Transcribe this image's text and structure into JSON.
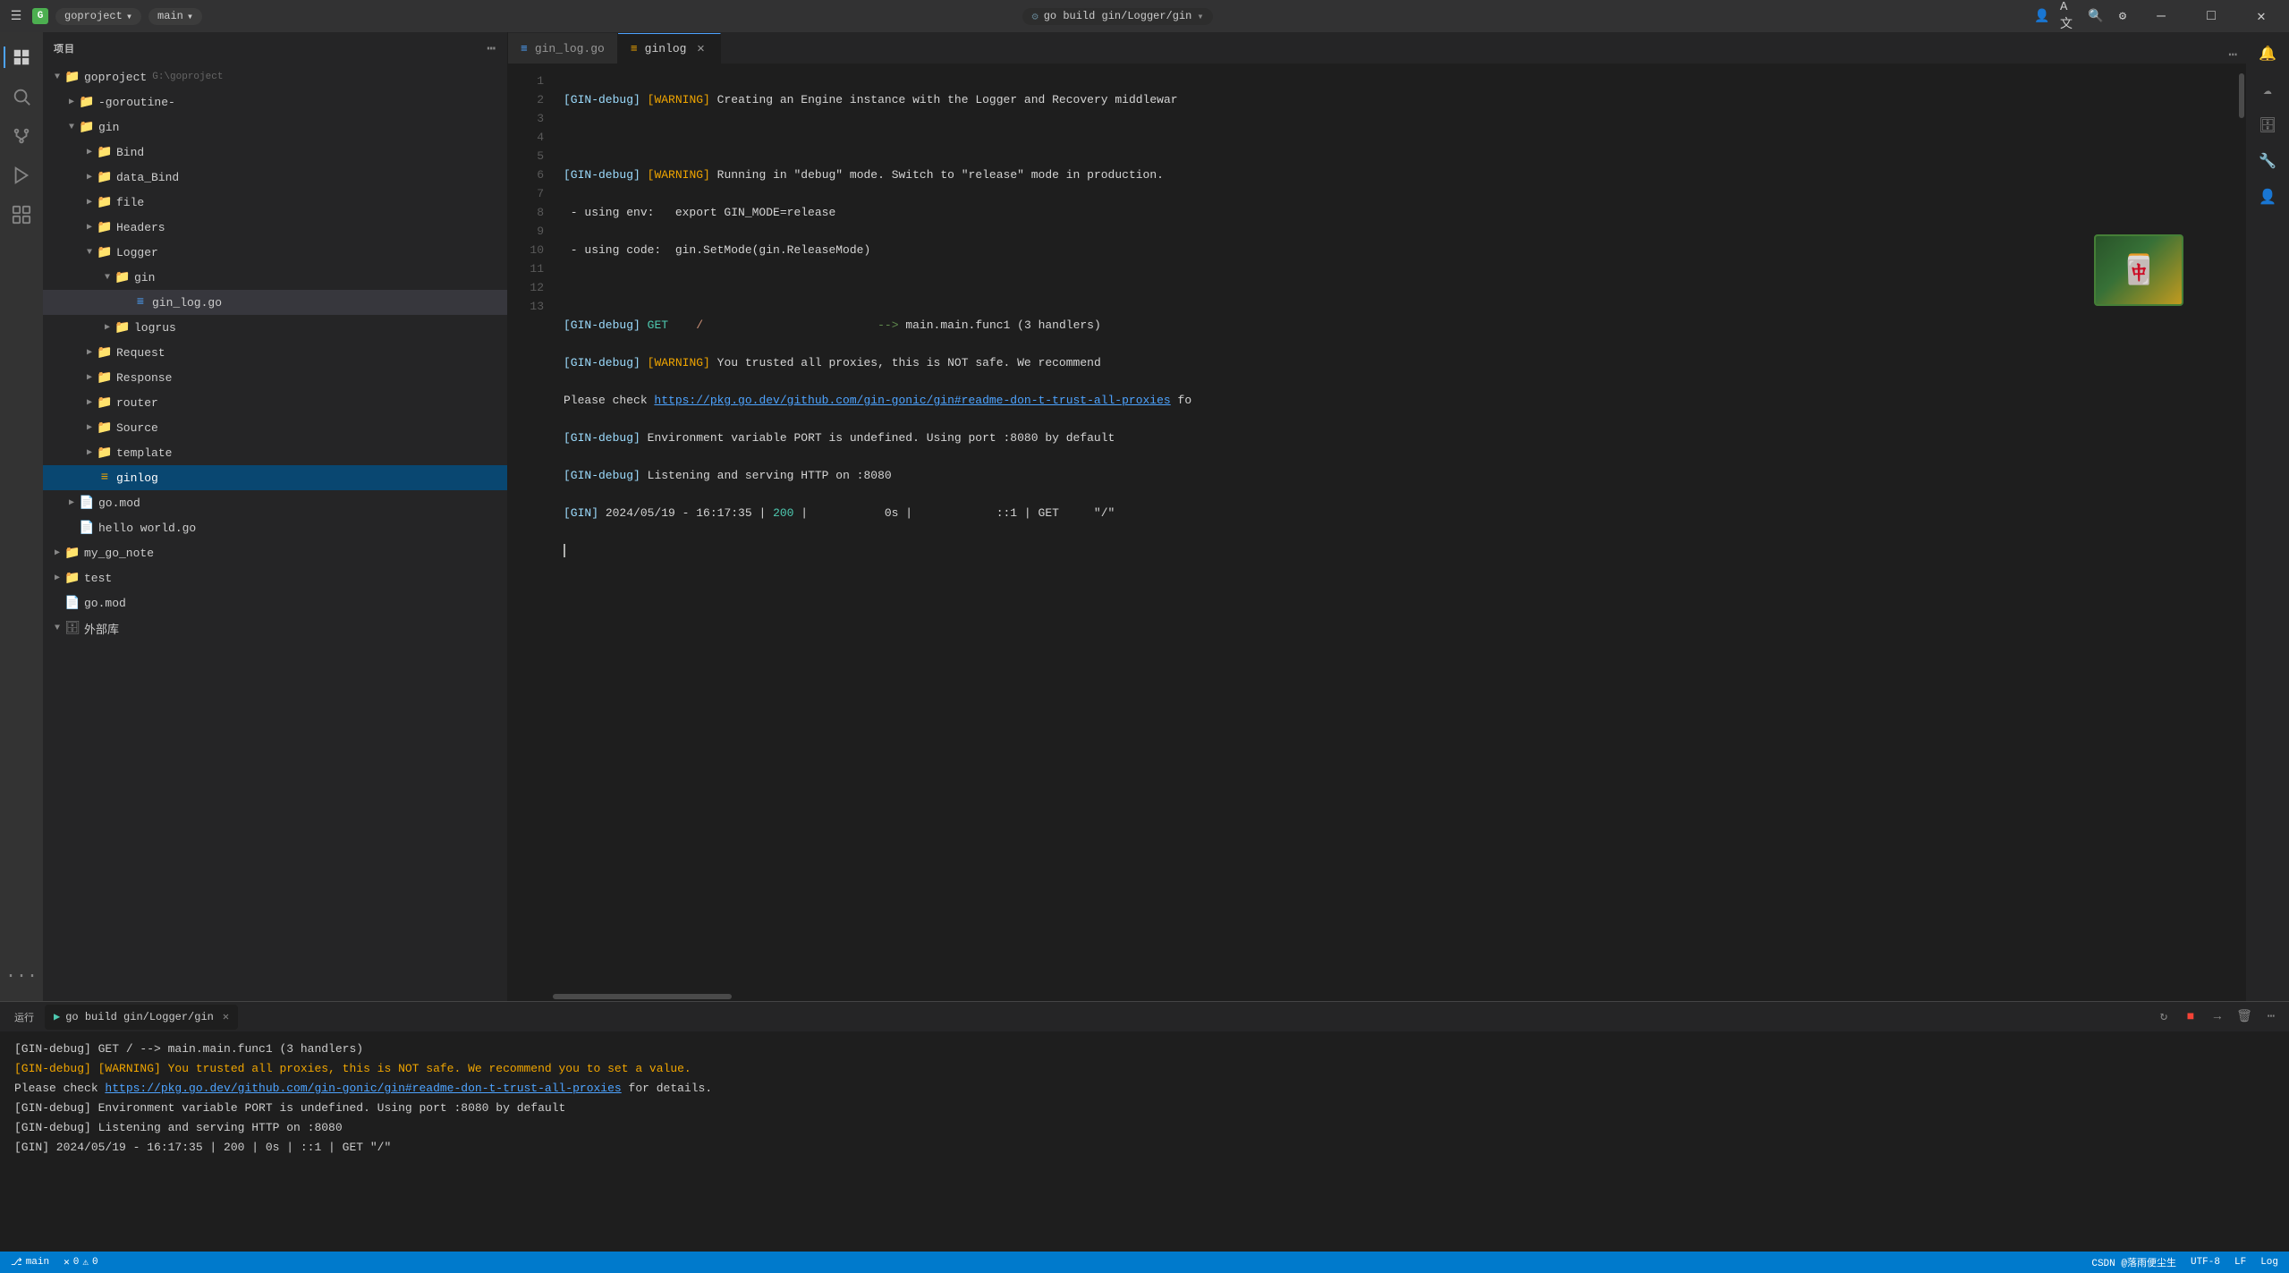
{
  "titleBar": {
    "appIcon": "G",
    "projectName": "goproject",
    "branch": "main",
    "buildLabel": "go build gin/Logger/gin",
    "windowControls": {
      "minimize": "—",
      "maximize": "□",
      "close": "✕"
    }
  },
  "activityBar": {
    "icons": [
      {
        "name": "explorer",
        "symbol": "⊞",
        "active": true
      },
      {
        "name": "search",
        "symbol": "🔍",
        "active": false
      },
      {
        "name": "source-control",
        "symbol": "⑂",
        "active": false
      },
      {
        "name": "run-debug",
        "symbol": "▷",
        "active": false
      },
      {
        "name": "extensions",
        "symbol": "⊟",
        "active": false
      },
      {
        "name": "more",
        "symbol": "···",
        "active": false
      }
    ]
  },
  "sidebar": {
    "header": "项目",
    "tree": [
      {
        "indent": 0,
        "arrow": "▼",
        "icon": "📁",
        "name": "goproject",
        "extra": "G:\\goproject",
        "type": "folder"
      },
      {
        "indent": 1,
        "arrow": "▶",
        "icon": "📁",
        "name": "-goroutine-",
        "type": "folder"
      },
      {
        "indent": 1,
        "arrow": "▼",
        "icon": "📁",
        "name": "gin",
        "type": "folder"
      },
      {
        "indent": 2,
        "arrow": "▶",
        "icon": "📁",
        "name": "Bind",
        "type": "folder"
      },
      {
        "indent": 2,
        "arrow": "▶",
        "icon": "📁",
        "name": "data_Bind",
        "type": "folder"
      },
      {
        "indent": 2,
        "arrow": "▶",
        "icon": "📁",
        "name": "file",
        "type": "folder"
      },
      {
        "indent": 2,
        "arrow": "▶",
        "icon": "📁",
        "name": "Headers",
        "type": "folder"
      },
      {
        "indent": 2,
        "arrow": "▼",
        "icon": "📁",
        "name": "Logger",
        "type": "folder"
      },
      {
        "indent": 3,
        "arrow": "▼",
        "icon": "📁",
        "name": "gin",
        "type": "folder"
      },
      {
        "indent": 4,
        "arrow": "",
        "icon": "📄",
        "name": "gin_log.go",
        "type": "go-file"
      },
      {
        "indent": 3,
        "arrow": "▶",
        "icon": "📁",
        "name": "logrus",
        "type": "folder"
      },
      {
        "indent": 2,
        "arrow": "▶",
        "icon": "📁",
        "name": "Request",
        "type": "folder"
      },
      {
        "indent": 2,
        "arrow": "▶",
        "icon": "📁",
        "name": "Response",
        "type": "folder"
      },
      {
        "indent": 2,
        "arrow": "▶",
        "icon": "📁",
        "name": "router",
        "type": "folder"
      },
      {
        "indent": 2,
        "arrow": "▶",
        "icon": "📁",
        "name": "Source",
        "type": "folder"
      },
      {
        "indent": 2,
        "arrow": "▶",
        "icon": "📁",
        "name": "template",
        "type": "folder"
      },
      {
        "indent": 2,
        "arrow": "",
        "icon": "≡",
        "name": "ginlog",
        "type": "ginlog-file",
        "selected": true
      },
      {
        "indent": 1,
        "arrow": "▶",
        "icon": "📄",
        "name": "go.mod",
        "type": "go-file"
      },
      {
        "indent": 1,
        "arrow": "",
        "icon": "📄",
        "name": "hello world.go",
        "type": "go-file"
      },
      {
        "indent": 0,
        "arrow": "▶",
        "icon": "📁",
        "name": "my_go_note",
        "type": "folder"
      },
      {
        "indent": 0,
        "arrow": "▶",
        "icon": "📁",
        "name": "test",
        "type": "folder"
      },
      {
        "indent": 0,
        "arrow": "",
        "icon": "📄",
        "name": "go.mod",
        "type": "go-file"
      },
      {
        "indent": 0,
        "arrow": "▼",
        "icon": "🗄",
        "name": "外部库",
        "type": "folder"
      }
    ]
  },
  "editor": {
    "tabs": [
      {
        "name": "gin_log.go",
        "active": false,
        "icon": "📄"
      },
      {
        "name": "ginlog",
        "active": true,
        "icon": "≡",
        "closable": true
      }
    ],
    "lines": [
      {
        "num": 1,
        "text": "[GIN-debug] [WARNING] Creating an Engine instance with the Logger and Recovery middlewar"
      },
      {
        "num": 2,
        "text": ""
      },
      {
        "num": 3,
        "text": "[GIN-debug] [WARNING] Running in \"debug\" mode. Switch to \"release\" mode in production."
      },
      {
        "num": 4,
        "text": " - using env:   export GIN_MODE=release"
      },
      {
        "num": 5,
        "text": " - using code:  gin.SetMode(gin.ReleaseMode)"
      },
      {
        "num": 6,
        "text": ""
      },
      {
        "num": 7,
        "text": "[GIN-debug] GET    /                         --> main.main.func1 (3 handlers)"
      },
      {
        "num": 8,
        "text": "[GIN-debug] [WARNING] You trusted all proxies, this is NOT safe. We recommend"
      },
      {
        "num": 9,
        "text": "Please check https://pkg.go.dev/github.com/gin-gonic/gin#readme-don-t-trust-all-proxies fo"
      },
      {
        "num": 10,
        "text": "[GIN-debug] Environment variable PORT is undefined. Using port :8080 by default"
      },
      {
        "num": 11,
        "text": "[GIN-debug] Listening and serving HTTP on :8080"
      },
      {
        "num": 12,
        "text": "[GIN] 2024/05/19 - 16:17:35 | 200 |           0s |            ::1 | GET     \"/\""
      },
      {
        "num": 13,
        "text": ""
      }
    ]
  },
  "terminal": {
    "runLabel": "运行",
    "tab": {
      "icon": "▶",
      "label": "go build gin/Logger/gin",
      "closable": true
    },
    "actionButtons": [
      "↻",
      "■",
      "→",
      "🗑",
      "⋯"
    ],
    "lines": [
      {
        "text": "[GIN-debug] GET     /                         --> main.main.func1 (3 handlers)",
        "type": "normal"
      },
      {
        "text": "[GIN-debug] [WARNING] You trusted all proxies, this is NOT safe. We recommend you to set a value.",
        "type": "warning"
      },
      {
        "text": "Please check https://pkg.go.dev/github.com/gin-gonic/gin#readme-don-t-trust-all-proxies for details.",
        "type": "link",
        "link": "https://pkg.go.dev/github.com/gin-gonic/gin#readme-don-t-trust-all-proxies"
      },
      {
        "text": "[GIN-debug] Environment variable PORT is undefined. Using port :8080 by default",
        "type": "normal"
      },
      {
        "text": "[GIN-debug] Listening and serving HTTP on :8080",
        "type": "normal"
      },
      {
        "text": "[GIN] 2024/05/19 - 16:17:35 | 200 |      0s |          ::1 | GET     \"/\"",
        "type": "normal"
      }
    ]
  },
  "statusBar": {
    "branch": "main",
    "errors": "0",
    "warnings": "0",
    "copyright": "CSDN @落雨便尘生",
    "encoding": "UTF-8",
    "lineEnding": "LF",
    "language": "Log"
  }
}
